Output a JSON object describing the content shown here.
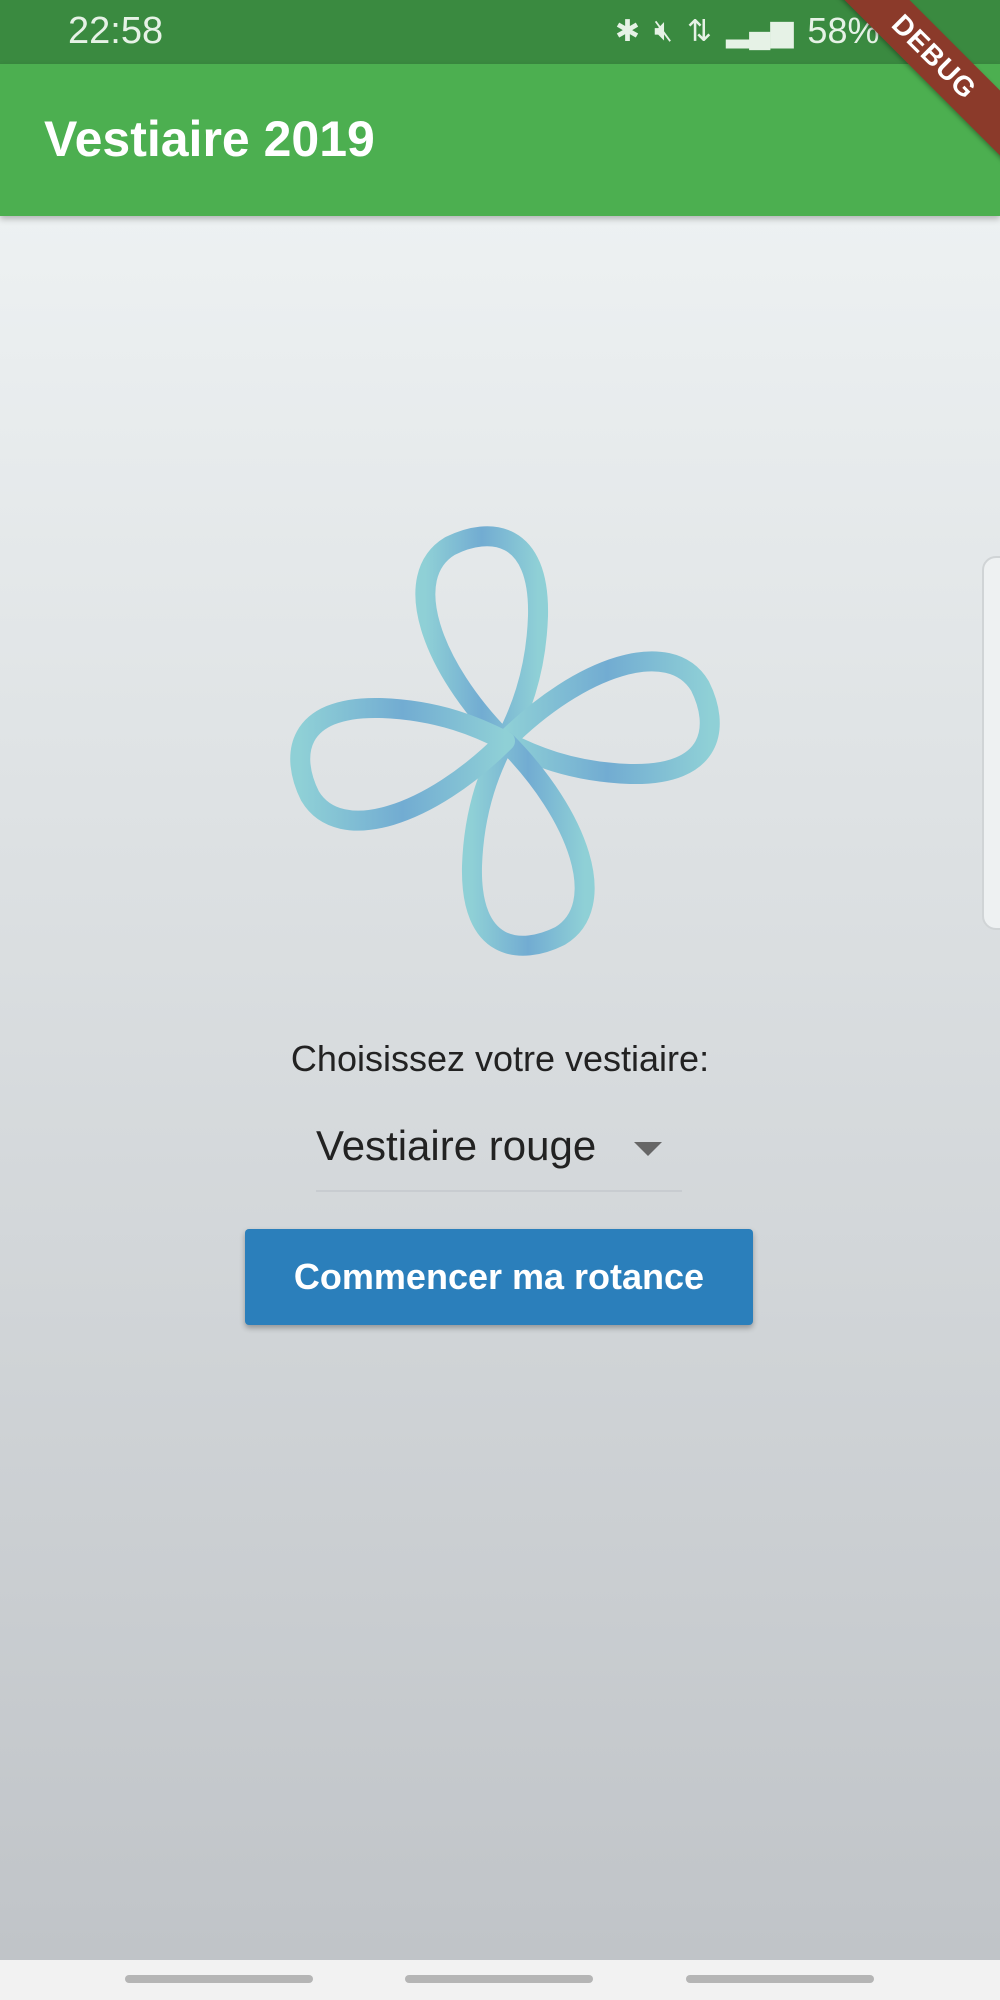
{
  "status_bar": {
    "time": "22:58",
    "battery": "58%",
    "icons": [
      "bluetooth-icon",
      "mute-icon",
      "network-4g-icon",
      "signal-icon",
      "battery-icon"
    ]
  },
  "app_bar": {
    "title": "Vestiaire 2019"
  },
  "debug_banner": "DEBUG",
  "main": {
    "prompt": "Choisissez votre vestiaire:",
    "dropdown": {
      "selected": "Vestiaire rouge"
    },
    "start_button": "Commencer ma rotance"
  },
  "colors": {
    "status_bar": "#3a8a40",
    "app_bar": "#4caf50",
    "button": "#2b7fbb",
    "logo": "#78b8d6"
  }
}
